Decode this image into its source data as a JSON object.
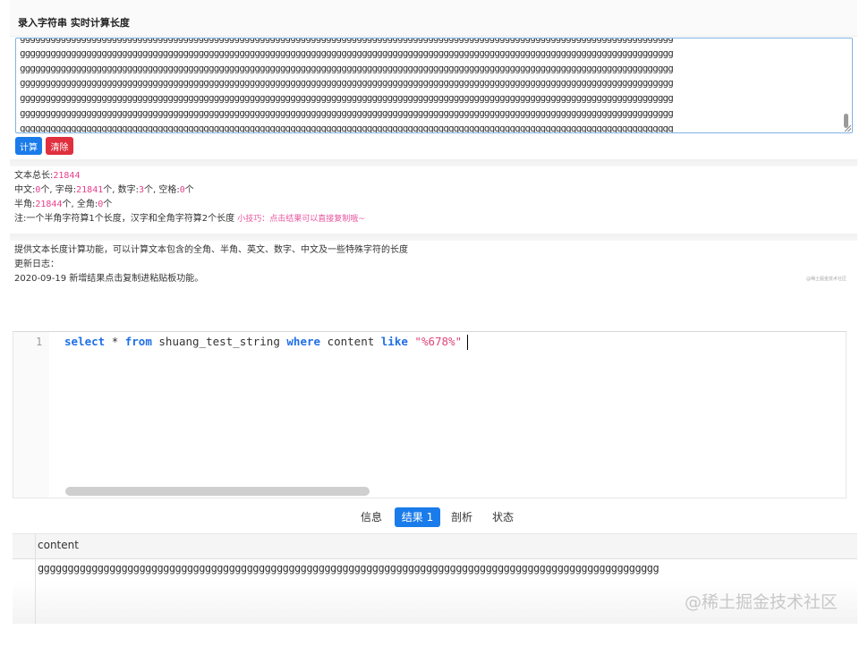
{
  "tool": {
    "title": "录入字符串 实时计算长度",
    "input_lines": [
      "gggggggggggggggggggggggggggggggggggggggggggggggggggggggggggggggggggggggggggggggggggggggggggggggggggggggggggggggggggggggggggggggg",
      "gggggggggggggggggggggggggggggggggggggggggggggggggggggggggggggggggggggggggggggggggggggggggggggggggggggggggggggggggggggggggggggggg",
      "gggggggggggggggggggggggggggggggggggggggggggggggggggggggggggggggggggggggggggggggggggggggggggggggggggggggggggggggggggggggggggggggg",
      "gggggggggggggggggggggggggggggggggggggggggggggggggggggggggggggggggggggggggggggggggggggggggggggggggggggggggggggggggggggggggggggggg",
      "gggggggggggggggggggggggggggggggggggggggggggggggggggggggggggggggggggggggggggggggggggggggggggggggggggggggggggggggggggggggggggggggg",
      "gggggggggggggggggggggggggggggggggggggggggggggggggggggggggggggggggggggggggggggggggggggggggggggggggggggggggggggggggggggggggggggggg",
      "gggggggggggggggggggggggggggggggggggggggggggggggggggggggggggggggggggggggggggggggggggggggggggggggggggggggggggggggggggggggggggggggg",
      "gggggggggggggggggggggggggggggggggggggggggggggggggggggggggggggggggggggggggggggggggggggggggggggggggggggggggggggggggggggggggggggggg",
      "ggggggggggggggggggggggggggggggggggggggggggggggggggggggggggggggggggggggggggggggggggggggggggggggggggggggggggggg678"
    ],
    "calc_label": "计算",
    "clear_label": "清除",
    "result": {
      "total_label": "文本总长:",
      "total_value": "21844",
      "chinese_label": "中文:",
      "chinese_value": "0",
      "letters_label": "个, 字母:",
      "letters_value": "21841",
      "digits_label": "个, 数字:",
      "digits_value": "3",
      "spaces_label": "个, 空格:",
      "spaces_value": "0",
      "unit": "个",
      "half_label": "半角:",
      "half_value": "21844",
      "full_label": "个, 全角:",
      "full_value": "0",
      "note": "注:一个半角字符算1个长度，汉字和全角字符算2个长度",
      "tip": "小技巧：点击结果可以直接复制哦~"
    },
    "info": {
      "description": "提供文本长度计算功能，可以计算文本包含的全角、半角、英文、数字、中文及一些特殊字符的长度",
      "changelog_title": "更新日志：",
      "changelog_entry": "2020-09-19 新增结果点击复制进粘贴板功能。"
    },
    "watermark_small": "@稀土掘金技术社区"
  },
  "editor": {
    "line_number": "1",
    "sql": {
      "kw_select": "select",
      "star": "*",
      "kw_from": "from",
      "table": "shuang_test_string",
      "kw_where": "where",
      "column": "content",
      "kw_like": "like",
      "pattern": "\"%678%\""
    }
  },
  "tabs": [
    {
      "label": "信息",
      "active": false
    },
    {
      "label": "结果 1",
      "active": true
    },
    {
      "label": "剖析",
      "active": false
    },
    {
      "label": "状态",
      "active": false
    }
  ],
  "grid": {
    "column": "content",
    "cell": "gggggggggggggggggggggggggggggggggggggggggggggggggggggggggggggggggggggggggggggggggggggggggggggggggggggggg"
  },
  "watermark": "@稀土掘金技术社区",
  "colors": {
    "accent": "#1a7bea",
    "danger": "#e0303f",
    "highlight": "#e83e8c"
  }
}
